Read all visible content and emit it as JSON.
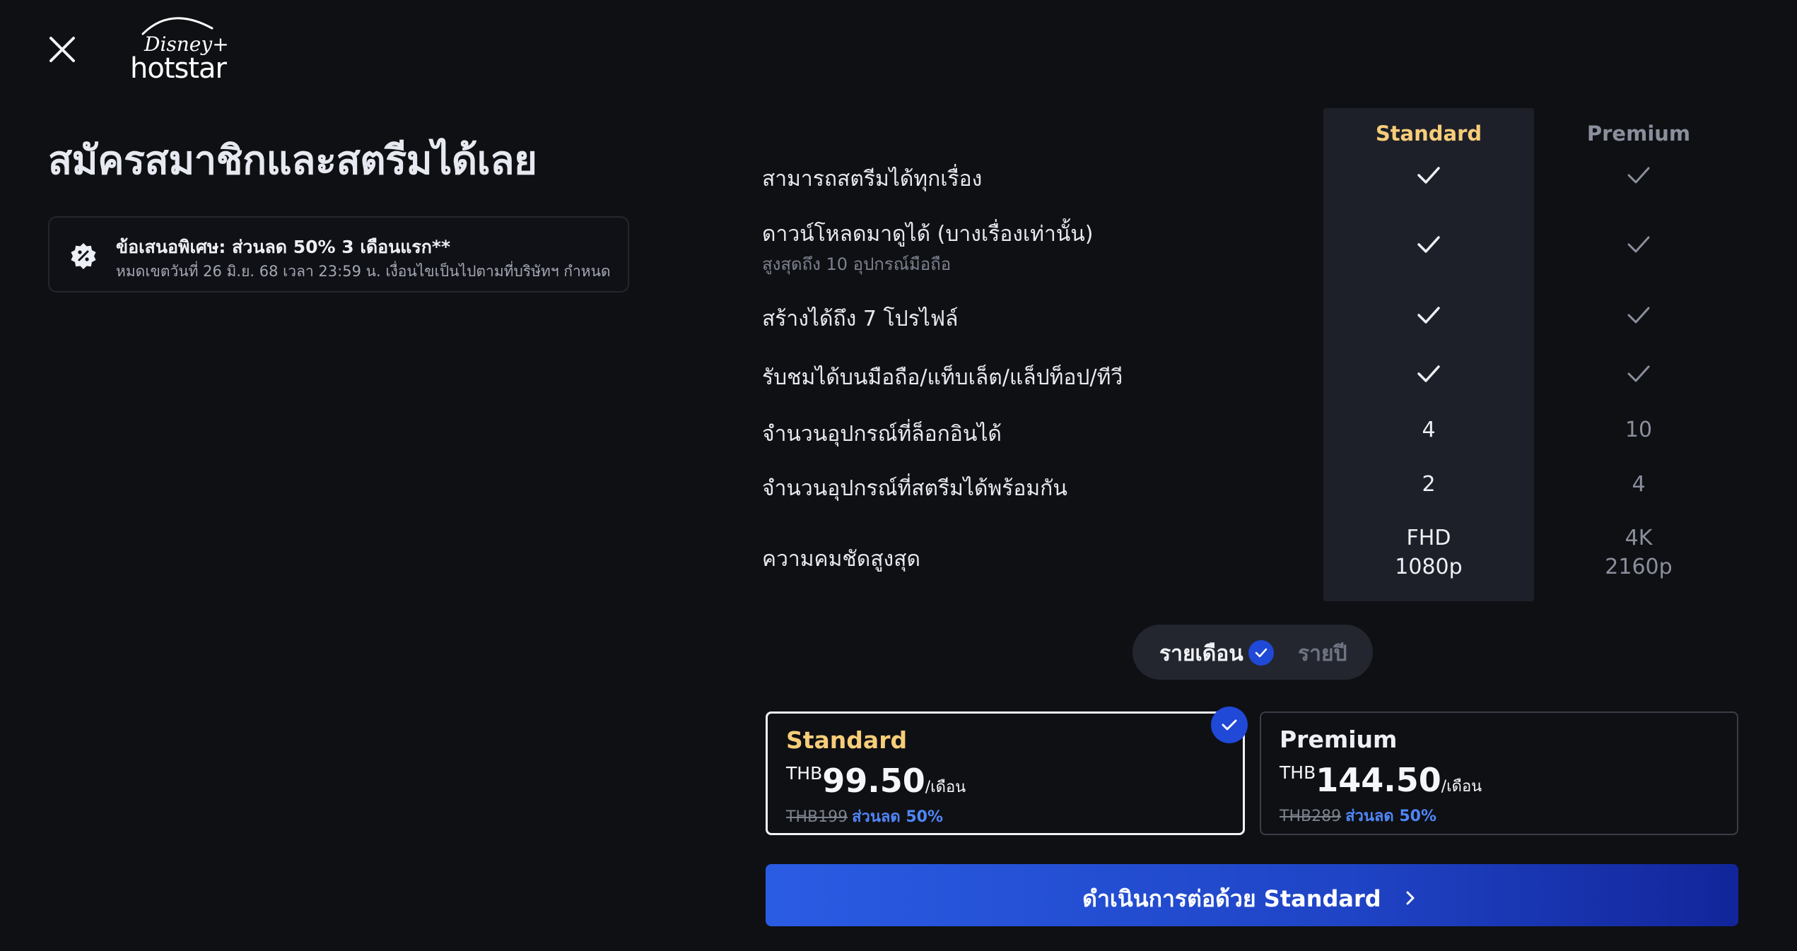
{
  "header": {
    "logo_line1": "Disney+",
    "logo_line2": "hotstar"
  },
  "page_title": "สมัครสมาชิกและสตรีมได้เลย",
  "offer": {
    "title": "ข้อเสนอพิเศษ: ส่วนลด 50% 3 เดือนแรก**",
    "subtitle": "หมดเขตวันที่ 26 มิ.ย. 68 เวลา 23:59 น. เงื่อนไขเป็นไปตามที่บริษัทฯ กำหนด"
  },
  "plans_table": {
    "columns": [
      "Standard",
      "Premium"
    ],
    "rows": [
      {
        "label": "สามารถสตรีมได้ทุกเรื่อง",
        "sub": "",
        "standard": "check",
        "premium": "check"
      },
      {
        "label": "ดาวน์โหลดมาดูได้ (บางเรื่องเท่านั้น)",
        "sub": "สูงสุดถึง 10 อุปกรณ์มือถือ",
        "standard": "check",
        "premium": "check"
      },
      {
        "label": "สร้างได้ถึง 7 โปรไฟล์",
        "sub": "",
        "standard": "check",
        "premium": "check"
      },
      {
        "label": "รับชมได้บนมือถือ/แท็บเล็ต/แล็ปท็อป/ทีวี",
        "sub": "",
        "standard": "check",
        "premium": "check"
      },
      {
        "label": "จำนวนอุปกรณ์ที่ล็อกอินได้",
        "sub": "",
        "standard": "4",
        "premium": "10"
      },
      {
        "label": "จำนวนอุปกรณ์ที่สตรีมได้พร้อมกัน",
        "sub": "",
        "standard": "2",
        "premium": "4"
      },
      {
        "label": "ความคมชัดสูงสุด",
        "sub": "",
        "standard": "FHD",
        "standard2": "1080p",
        "premium": "4K",
        "premium2": "2160p"
      }
    ]
  },
  "billing_toggle": {
    "monthly": "รายเดือน",
    "yearly": "รายปี",
    "selected": "monthly"
  },
  "plan_cards": [
    {
      "name": "Standard",
      "currency": "THB",
      "price": "99.50",
      "period": "/เดือน",
      "old_price": "THB199",
      "discount": "ส่วนลด 50%",
      "selected": true
    },
    {
      "name": "Premium",
      "currency": "THB",
      "price": "144.50",
      "period": "/เดือน",
      "old_price": "THB289",
      "discount": "ส่วนลด 50%",
      "selected": false
    }
  ],
  "cta": {
    "label": "ดำเนินการต่อด้วย Standard"
  },
  "colors": {
    "background": "#0f1014",
    "standard_accent": "#f6cd79",
    "primary_blue": "#1f49d6",
    "discount_blue": "#4f86f7"
  },
  "icons": [
    "close-icon",
    "disney-hotstar-logo",
    "discount-badge-icon",
    "check-icon",
    "chevron-right-icon"
  ]
}
